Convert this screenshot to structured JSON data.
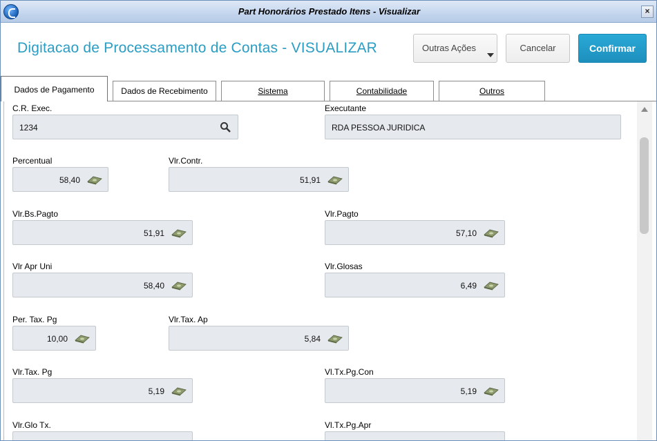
{
  "window": {
    "title": "Part Honorários Prestado Itens - Visualizar",
    "close_label": "×"
  },
  "header": {
    "page_title": "Digitacao de Processamento de Contas - VISUALIZAR",
    "outras_acoes": "Outras Ações",
    "cancelar": "Cancelar",
    "confirmar": "Confirmar"
  },
  "tabs": [
    {
      "label": "Dados de Pagamento",
      "active": true
    },
    {
      "label": "Dados de Recebimento",
      "active": false
    },
    {
      "label": "Sistema",
      "active": false
    },
    {
      "label": "Contabilidade",
      "active": false
    },
    {
      "label": "Outros",
      "active": false
    }
  ],
  "fields": {
    "cr_exec": {
      "label": "C.R. Exec.",
      "value": "1234"
    },
    "executante": {
      "label": "Executante",
      "value": "RDA PESSOA JURIDICA"
    },
    "percentual": {
      "label": "Percentual",
      "value": "58,40"
    },
    "vlr_contr": {
      "label": "Vlr.Contr.",
      "value": "51,91"
    },
    "vlr_bs_pagto": {
      "label": "Vlr.Bs.Pagto",
      "value": "51,91"
    },
    "vlr_pagto": {
      "label": "Vlr.Pagto",
      "value": "57,10"
    },
    "vlr_apr_uni": {
      "label": "Vlr Apr Uni",
      "value": "58,40"
    },
    "vlr_glosas": {
      "label": "Vlr.Glosas",
      "value": "6,49"
    },
    "per_tax_pg": {
      "label": "Per. Tax. Pg",
      "value": "10,00"
    },
    "vlr_tax_ap": {
      "label": "Vlr.Tax. Ap",
      "value": "5,84"
    },
    "vlr_tax_pg": {
      "label": "Vlr.Tax. Pg",
      "value": "5,19"
    },
    "vl_tx_pg_con": {
      "label": "Vl.Tx.Pg.Con",
      "value": "5,19"
    },
    "vlr_glo_tx": {
      "label": "Vlr.Glo Tx.",
      "value": ""
    },
    "vl_tx_pg_apr": {
      "label": "Vl.Tx.Pg.Apr",
      "value": ""
    }
  },
  "colors": {
    "accent": "#2a9dc4",
    "confirm": "#1d9ac7",
    "field_bg": "#e6e9ee"
  },
  "icons": [
    "app-logo-icon",
    "close-icon",
    "chevron-down-icon",
    "search-icon",
    "money-icon"
  ]
}
